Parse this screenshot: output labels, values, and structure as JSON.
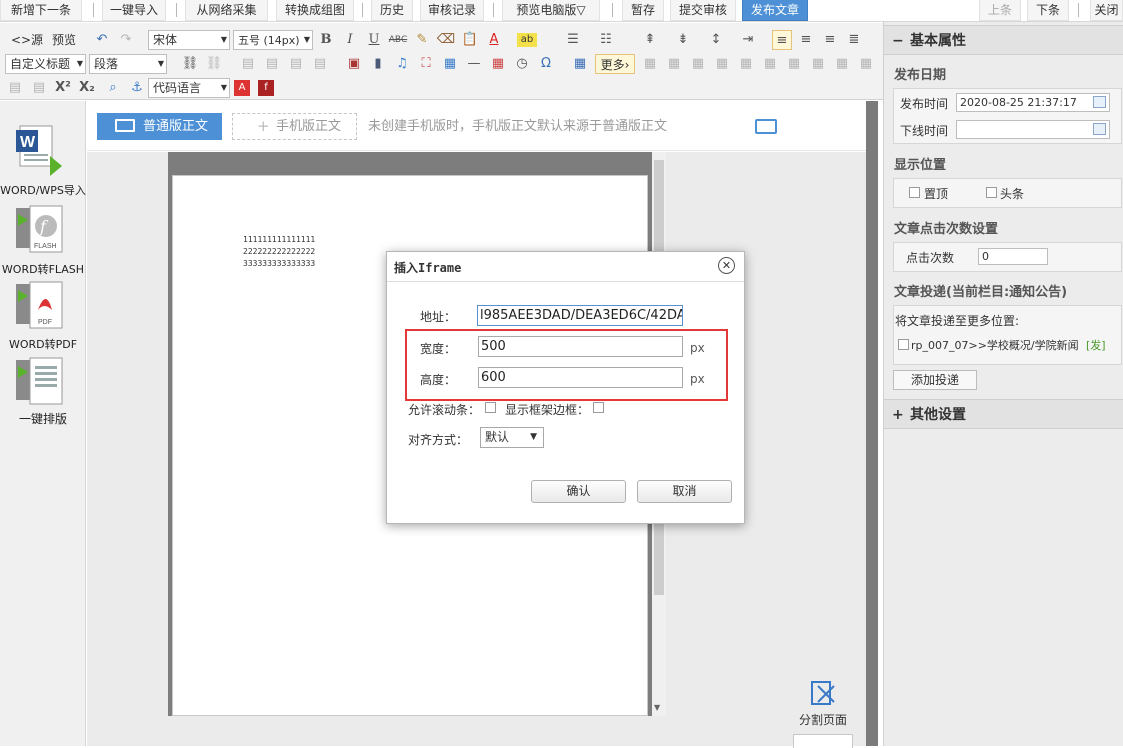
{
  "topbar": {
    "buttons": [
      "新增下一条",
      "一键导入",
      "从网络采集",
      "转换成组图",
      "历史",
      "审核记录",
      "预览电脑版▽",
      "暂存",
      "提交审核",
      "发布文章"
    ],
    "nav": [
      "上条",
      "下条",
      "关闭"
    ]
  },
  "toolbar": {
    "source_label": "<>源码",
    "preview_label": "预览",
    "font_family": "宋体",
    "font_size": "五号 (14px)",
    "custom_heading": "自定义标题",
    "paragraph": "段落",
    "code_lang": "代码语言",
    "more_label": "更多"
  },
  "left_panel": {
    "items": [
      "WORD/WPS导入",
      "WORD转FLASH",
      "WORD转PDF",
      "一键排版"
    ]
  },
  "editor": {
    "tab_normal": "普通版正文",
    "tab_mobile": "手机版正文",
    "tab_hint": "未创建手机版时，手机版正文默认来源于普通版正文",
    "content_lines": [
      "111111111111111",
      "222222222222222",
      "333333333333333"
    ],
    "split_page": "分割页面"
  },
  "dialog": {
    "title": "插入Iframe",
    "address_label": "地址：",
    "address_value": "l985AEE3DAD/DEA3ED6C/42DA",
    "width_label": "宽度：",
    "width_value": "500",
    "height_label": "高度：",
    "height_value": "600",
    "unit": "px",
    "scroll_label": "允许滚动条：",
    "border_label": "显示框架边框：",
    "align_label": "对齐方式：",
    "align_value": "默认",
    "confirm": "确认",
    "cancel": "取消"
  },
  "right_panel": {
    "header": "基本属性",
    "publish_date_title": "发布日期",
    "publish_time_label": "发布时间",
    "publish_time_value": "2020-08-25 21:37:17",
    "offline_time_label": "下线时间",
    "offline_time_value": "",
    "display_pos_title": "显示位置",
    "pin_top": "置顶",
    "headline": "头条",
    "click_title": "文章点击次数设置",
    "click_label": "点击次数",
    "click_value": "0",
    "deliver_title": "文章投递(当前栏目:通知公告)",
    "deliver_more": "将文章投递至更多位置:",
    "deliver_item": "rp_007_07>>学校概况/学院新闻",
    "deliver_tag": "[发]",
    "add_deliver": "添加投递",
    "other_header": "其他设置"
  },
  "colors": {
    "accent": "#4d90d6",
    "highlight_box": "#e23838"
  }
}
